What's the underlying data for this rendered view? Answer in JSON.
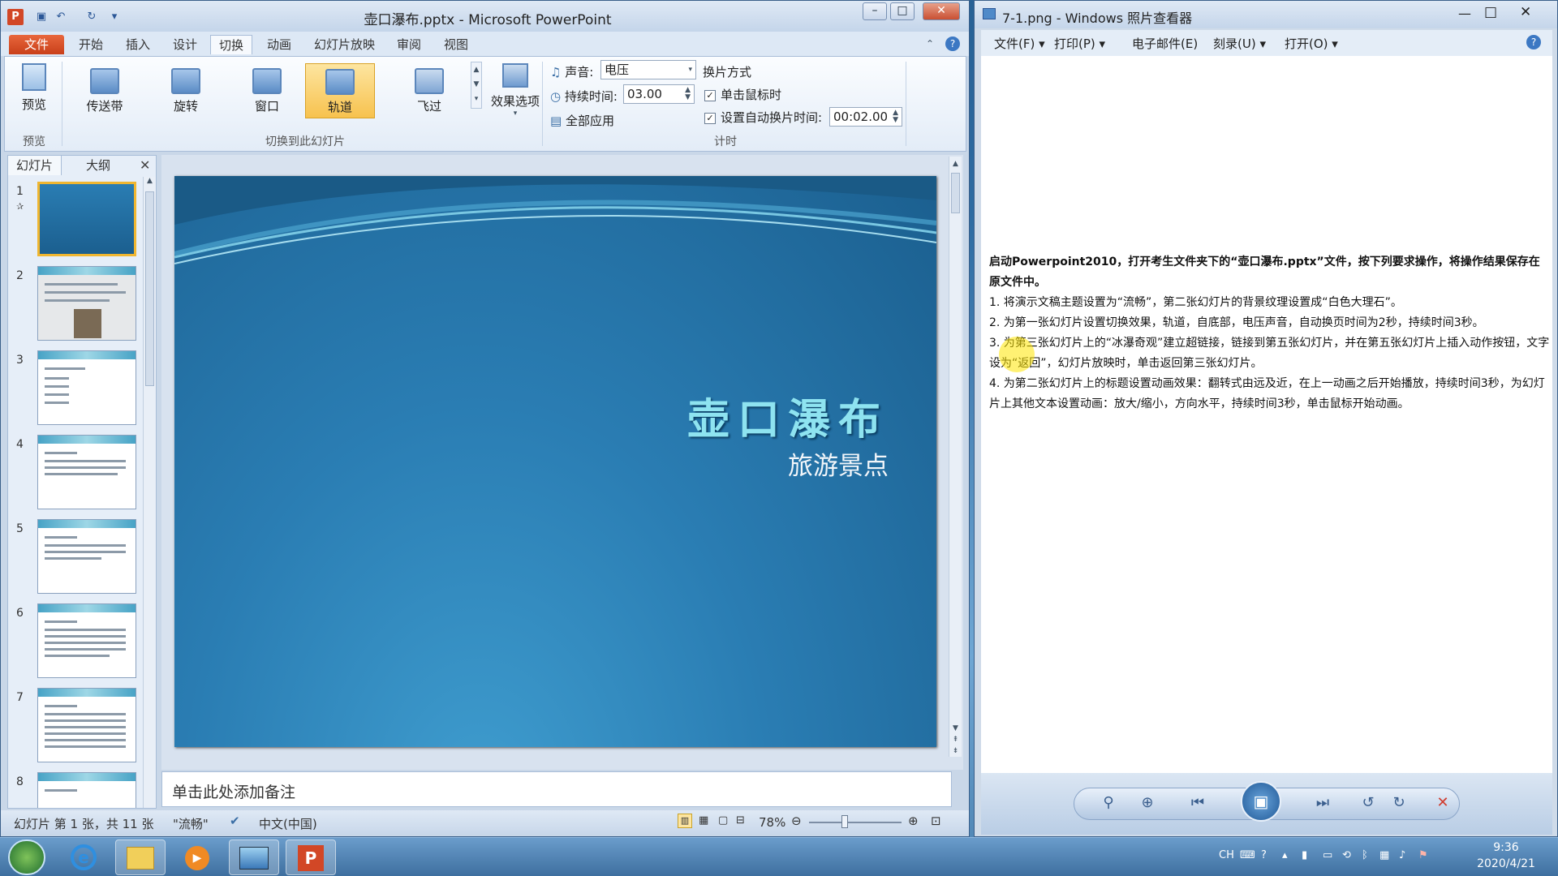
{
  "ppt": {
    "title": "壶口瀑布.pptx - Microsoft PowerPoint",
    "tabs": [
      "文件",
      "开始",
      "插入",
      "设计",
      "切换",
      "动画",
      "幻灯片放映",
      "审阅",
      "视图"
    ],
    "ribbon": {
      "preview_label": "预览",
      "preview_group": "预览",
      "transitions": [
        "传送带",
        "旋转",
        "窗口",
        "轨道",
        "飞过"
      ],
      "selected_transition": "轨道",
      "effect_options": "效果选项",
      "group_label": "切换到此幻灯片",
      "sound_label": "声音:",
      "sound_value": "电压",
      "duration_label": "持续时间:",
      "duration_value": "03.00",
      "apply_all": "全部应用",
      "advance_title": "换片方式",
      "on_click": "单击鼠标时",
      "auto_after": "设置自动换片时间:",
      "auto_time": "00:02.00",
      "timing_group": "计时"
    },
    "pane_tabs": [
      "幻灯片",
      "大纲"
    ],
    "thumbnails": [
      "1",
      "2",
      "3",
      "4",
      "5",
      "6",
      "7",
      "8"
    ],
    "slide": {
      "title": "壶口瀑布",
      "subtitle": "旅游景点"
    },
    "notes_placeholder": "单击此处添加备注",
    "status": {
      "slide_info": "幻灯片 第 1 张，共 11 张",
      "theme": "\"流畅\"",
      "language": "中文(中国)",
      "zoom": "78%"
    }
  },
  "viewer": {
    "title": "7-1.png - Windows 照片查看器",
    "menu": [
      "文件(F)",
      "打印(P)",
      "电子邮件(E)",
      "刻录(U)",
      "打开(O)"
    ],
    "text": [
      "启动Powerpoint2010，打开考生文件夹下的“壶口瀑布.pptx”文件，按下列要求操作，将操作结果保存在原文件中。",
      "1. 将演示文稿主题设置为“流畅”，第二张幻灯片的背景纹理设置成“白色大理石”。",
      "2. 为第一张幻灯片设置切换效果，轨道，自底部，电压声音，自动换页时间为2秒，持续时间3秒。",
      "3. 为第三张幻灯片上的“冰瀑奇观”建立超链接，链接到第五张幻灯片，并在第五张幻灯片上插入动作按钮，文字设为“返回”，幻灯片放映时，单击返回第三张幻灯片。",
      "4. 为第二张幻灯片上的标题设置动画效果：翻转式由远及近，在上一动画之后开始播放，持续时间3秒，为幻灯片上其他文本设置动画：放大/缩小，方向水平，持续时间3秒，单击鼠标开始动画。"
    ]
  },
  "taskbar": {
    "time": "9:36",
    "date": "2020/4/21",
    "lang": "CH"
  }
}
